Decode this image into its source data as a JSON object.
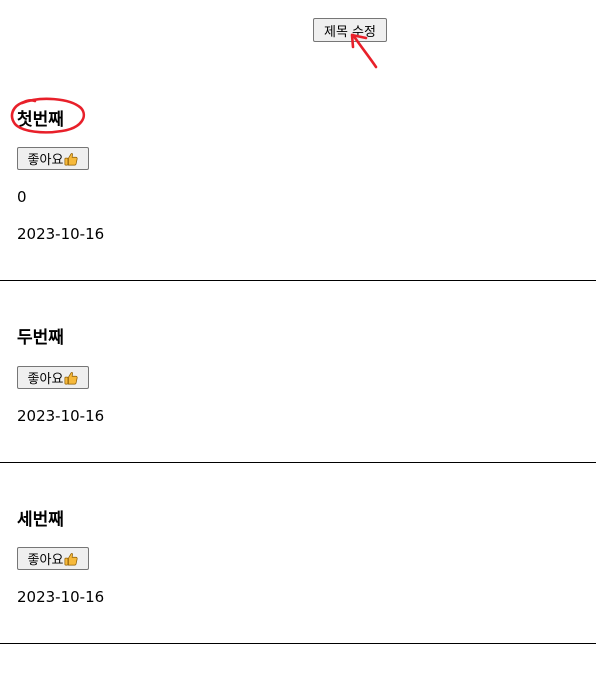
{
  "header": {
    "edit_title_label": "제목 수정"
  },
  "posts": [
    {
      "title": "첫번째",
      "like_label": "좋아요",
      "like_icon": "thumbs-up-icon",
      "count": "0",
      "date": "2023-10-16"
    },
    {
      "title": "두번째",
      "like_label": "좋아요",
      "like_icon": "thumbs-up-icon",
      "date": "2023-10-16"
    },
    {
      "title": "세번째",
      "like_label": "좋아요",
      "like_icon": "thumbs-up-icon",
      "date": "2023-10-16"
    }
  ],
  "annotation": {
    "color": "#e8202a"
  },
  "colors": {
    "thumb": "#f6b93b",
    "divider": "#000000"
  }
}
